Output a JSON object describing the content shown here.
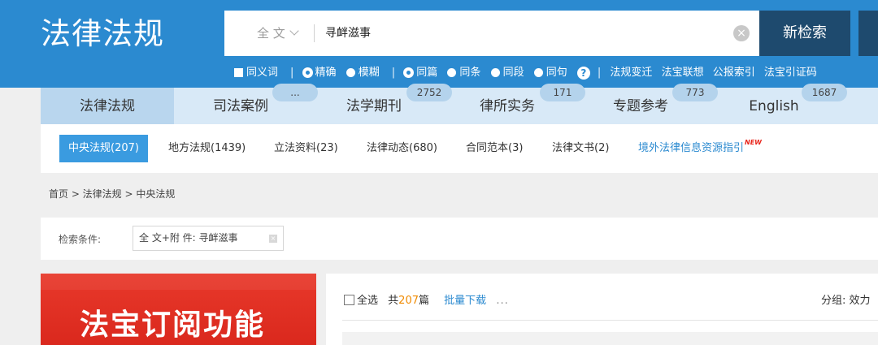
{
  "header": {
    "logo": "法律法规",
    "search": {
      "scope": "全 文",
      "query": "寻衅滋事",
      "button_label": "新检索"
    },
    "options": {
      "synonym": "同义词",
      "pipe": "|",
      "modes": [
        "精确",
        "模糊"
      ],
      "ranges": [
        "同篇",
        "同条",
        "同段",
        "同句"
      ],
      "help": "?",
      "links": [
        "法规变迁",
        "法宝联想",
        "公报索引",
        "法宝引证码"
      ]
    }
  },
  "tabs": [
    {
      "label": "法律法规",
      "badge": ""
    },
    {
      "label": "司法案例",
      "badge": "..."
    },
    {
      "label": "法学期刊",
      "badge": "2752"
    },
    {
      "label": "律所实务",
      "badge": "171"
    },
    {
      "label": "专题参考",
      "badge": "773"
    },
    {
      "label": "English",
      "badge": "1687"
    }
  ],
  "subnav": {
    "items": [
      "中央法规(207)",
      "地方法规(1439)",
      "立法资料(23)",
      "法律动态(680)",
      "合同范本(3)",
      "法律文书(2)"
    ],
    "guide_link": "境外法律信息资源指引",
    "new_tag": "NEW"
  },
  "breadcrumb": "首页 > 法律法规 > 中央法规",
  "conditions": {
    "label": "检索条件:",
    "chip": "全 文+附 件:  寻衅滋事",
    "chip_close": "×"
  },
  "banner": {
    "text": "法宝订阅功能"
  },
  "results": {
    "select_all": "全选",
    "total_prefix": "共",
    "total_count": "207",
    "total_suffix": "篇",
    "batch_download": "批量下载",
    "more": "...",
    "group_by": "分组: 效力"
  },
  "colors": {
    "header_bg": "#2b8ad0",
    "search_button": "#1e4a6e",
    "tab_bar": "#d8e9f7",
    "active_sub": "#3a9be0",
    "count_orange": "#f08a00",
    "banner_red": "#e8392b"
  }
}
